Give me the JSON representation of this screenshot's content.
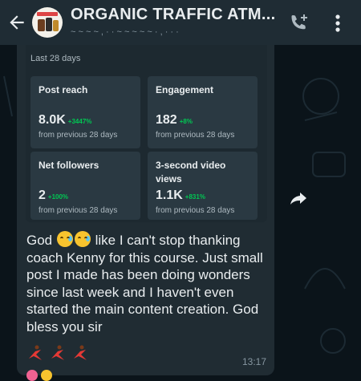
{
  "header": {
    "title": "ORGANIC TRAFFIC ATM...",
    "subtitle": "~ ~ ~ ~ ,  ·  · ~ ~ ~ ~ ~ · ,  · · ·"
  },
  "insights": {
    "range": "Last 28 days",
    "tiles": [
      {
        "name": "Post reach",
        "value": "8.0K",
        "change": "+3447%",
        "note": "from previous 28 days"
      },
      {
        "name": "Engagement",
        "value": "182",
        "change": "+8%",
        "note": "from previous 28 days"
      },
      {
        "name": "Net followers",
        "value": "2",
        "change": "+100%",
        "note": "from previous 28 days"
      },
      {
        "name": "3-second video views",
        "value": "1.1K",
        "change": "+831%",
        "note": "from previous 28 days"
      }
    ]
  },
  "message": {
    "text_before_emoji": "God",
    "text_after_emoji": " like I can't stop thanking coach Kenny for this course. Just small post I made has been doing wonders since last week and I haven't even started the main content creation. God bless you sir",
    "time": "13:17"
  },
  "colors": {
    "background": "#0b141a",
    "header": "#1f2c34",
    "bubble": "#202c33",
    "positive": "#00c853"
  }
}
